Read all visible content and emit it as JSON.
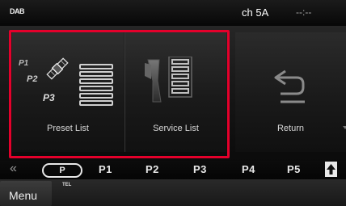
{
  "status": {
    "source": "DAB",
    "channel": "ch 5A",
    "clock": "--:--"
  },
  "tiles": {
    "preset_label": "Preset List",
    "preset_icon_p1": "P1",
    "preset_icon_p2": "P2",
    "preset_icon_p3": "P3",
    "service_label": "Service List",
    "return_label": "Return"
  },
  "preset_strip": {
    "left_arrow": "«",
    "p_button": "P",
    "presets": [
      "P1",
      "P2",
      "P3",
      "P4",
      "P5"
    ]
  },
  "bottom": {
    "menu_label": "Menu",
    "tel_label": "TEL"
  },
  "colors": {
    "highlight": "#e4002b"
  },
  "icons": {
    "preset": "satellite-list-icon",
    "service": "antenna-list-icon",
    "return": "return-arrow-icon",
    "scroll_up": "up-arrow-icon"
  }
}
